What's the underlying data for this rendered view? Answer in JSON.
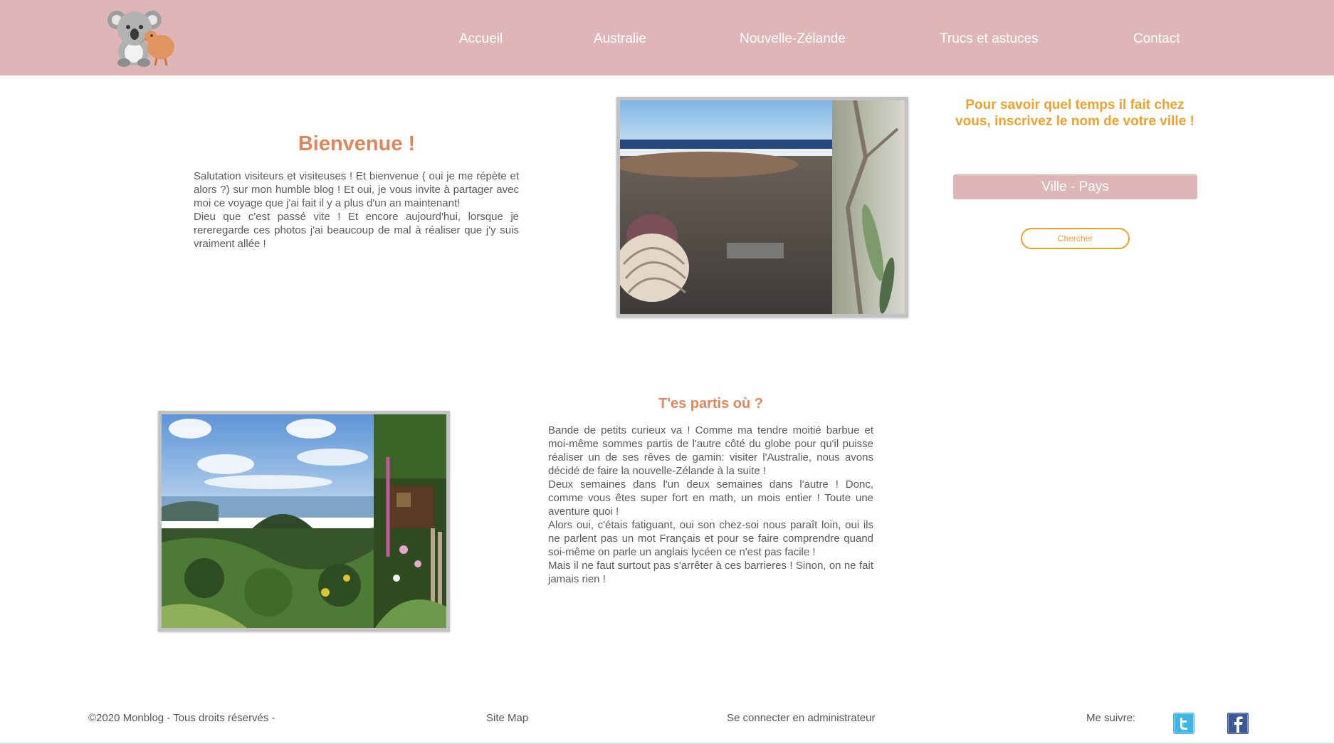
{
  "header": {
    "logo_alt": "koala-kiwi-logo",
    "nav": [
      {
        "label": "Accueil"
      },
      {
        "label": "Australie"
      },
      {
        "label": "Nouvelle-Zélande"
      },
      {
        "label": "Trucs et astuces"
      },
      {
        "label": "Contact"
      }
    ]
  },
  "welcome": {
    "title": "Bienvenue !",
    "paragraphs": [
      "Salutation visiteurs et visiteuses ! Et bienvenue ( oui je me répète et alors ?) sur mon humble blog ! Et oui, je vous invite à partager avec moi ce voyage que j'ai fait il y a plus d'un an maintenant!",
      "Dieu que c'est passé vite ! Et encore aujourd'hui, lorsque je rereregarde ces photos j'ai beaucoup de mal à réaliser que j'y suis vraiment allée !"
    ]
  },
  "weather": {
    "title": "Pour savoir quel temps il fait chez vous, inscrivez le nom de votre ville !",
    "placeholder": "Ville - Pays",
    "button_label": "Chercher"
  },
  "trip": {
    "title": "T'es partis où ?",
    "paragraphs": [
      "Bande de petits curieux va ! Comme ma tendre moitié barbue et moi-même sommes partis de l'autre côté du globe pour qu'il puisse réaliser un de ses rêves de gamin: visiter l'Australie, nous avons décidé de faire la nouvelle-Zélande à la suite !",
      "Deux semaines dans l'un deux semaines dans l'autre ! Donc, comme vous êtes super fort en math, un mois entier ! Toute une aventure quoi !",
      "Alors oui, c'étais fatiguant, oui son chez-soi nous paraît loin, oui ils ne parlent pas un mot Français et pour se faire comprendre quand soi-même on parle un anglais lycéen ce n'est pas facile !",
      "Mais il ne faut surtout pas s'arrêter à ces barrieres ! Sinon, on ne fait jamais rien !"
    ]
  },
  "footer": {
    "copyright": "©2020 Monblog - Tous droits réservés -",
    "sitemap": "Site Map",
    "admin": "Se connecter en administrateur",
    "follow": "Me suivre:",
    "social": [
      "twitter-icon",
      "facebook-icon"
    ]
  },
  "colors": {
    "header_bg": "#dfb6b7",
    "title_orange": "#e0865a",
    "accent_orange": "#f0a02c",
    "twitter_blue": "#3fb6e8",
    "facebook_blue": "#3b5998"
  }
}
